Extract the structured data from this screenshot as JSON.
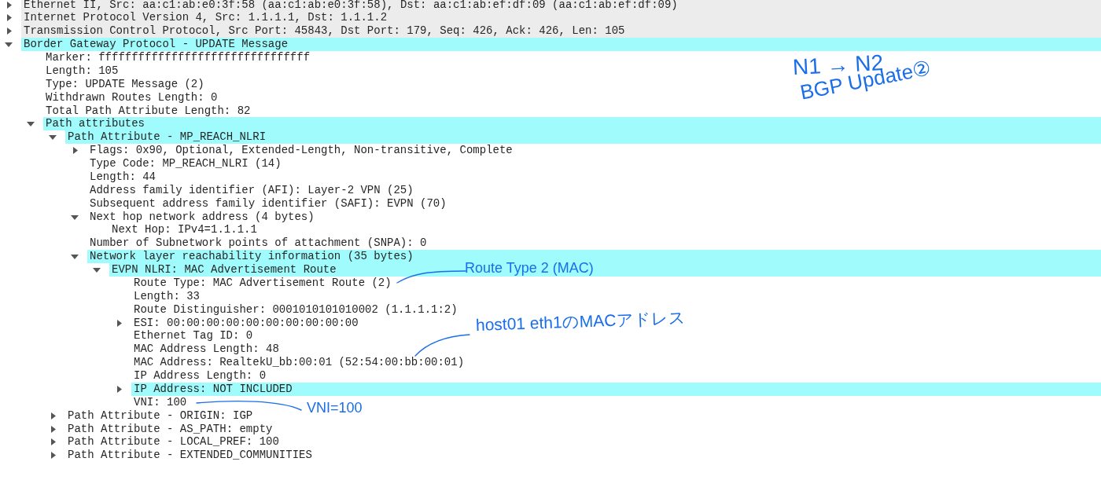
{
  "tree": [
    {
      "label": "Ethernet II, Src: aa:c1:ab:e0:3f:58 (aa:c1:ab:e0:3f:58), Dst: aa:c1:ab:ef:df:09 (aa:c1:ab:ef:df:09)",
      "expanded": false,
      "color": "#ececec"
    },
    {
      "label": "Internet Protocol Version 4, Src: 1.1.1.1, Dst: 1.1.1.2",
      "expanded": false,
      "color": "#ececec"
    },
    {
      "label": "Transmission Control Protocol, Src Port: 45843, Dst Port: 179, Seq: 426, Ack: 426, Len: 105",
      "expanded": false,
      "color": "#ececec"
    },
    {
      "label": "Border Gateway Protocol - UPDATE Message",
      "expanded": true,
      "color": "#a0fcfc",
      "children": [
        {
          "label": "Marker: ffffffffffffffffffffffffffffffff"
        },
        {
          "label": "Length: 105"
        },
        {
          "label": "Type: UPDATE Message (2)"
        },
        {
          "label": "Withdrawn Routes Length: 0"
        },
        {
          "label": "Total Path Attribute Length: 82"
        },
        {
          "label": "Path attributes",
          "expanded": true,
          "color": "#a0fcfc",
          "children": [
            {
              "label": "Path Attribute - MP_REACH_NLRI",
              "expanded": true,
              "color": "#a0fcfc",
              "children": [
                {
                  "label": "Flags: 0x90, Optional, Extended-Length, Non-transitive, Complete",
                  "expanded": false
                },
                {
                  "label": "Type Code: MP_REACH_NLRI (14)"
                },
                {
                  "label": "Length: 44"
                },
                {
                  "label": "Address family identifier (AFI): Layer-2 VPN (25)"
                },
                {
                  "label": "Subsequent address family identifier (SAFI): EVPN (70)"
                },
                {
                  "label": "Next hop network address (4 bytes)",
                  "expanded": true,
                  "children": [
                    {
                      "label": "Next Hop: IPv4=1.1.1.1"
                    }
                  ]
                },
                {
                  "label": "Number of Subnetwork points of attachment (SNPA): 0"
                },
                {
                  "label": "Network layer reachability information (35 bytes)",
                  "expanded": true,
                  "color": "#a0fcfc",
                  "children": [
                    {
                      "label": "EVPN NLRI: MAC Advertisement Route",
                      "expanded": true,
                      "color": "#a0fcfc",
                      "children": [
                        {
                          "label": "Route Type: MAC Advertisement Route (2)"
                        },
                        {
                          "label": "Length: 33"
                        },
                        {
                          "label": "Route Distinguisher: 0001010101010002 (1.1.1.1:2)"
                        },
                        {
                          "label": "ESI: 00:00:00:00:00:00:00:00:00:00",
                          "expanded": false
                        },
                        {
                          "label": "Ethernet Tag ID: 0"
                        },
                        {
                          "label": "MAC Address Length: 48"
                        },
                        {
                          "label": "MAC Address: RealtekU_bb:00:01 (52:54:00:bb:00:01)"
                        },
                        {
                          "label": "IP Address Length: 0"
                        },
                        {
                          "label": "IP Address: NOT INCLUDED",
                          "expanded": false,
                          "color": "#a0fcfc"
                        },
                        {
                          "label": "VNI: 100"
                        }
                      ]
                    }
                  ]
                }
              ]
            },
            {
              "label": "Path Attribute - ORIGIN: IGP",
              "expanded": false
            },
            {
              "label": "Path Attribute - AS_PATH: empty",
              "expanded": false
            },
            {
              "label": "Path Attribute - LOCAL_PREF: 100",
              "expanded": false
            },
            {
              "label": "Path Attribute - EXTENDED_COMMUNITIES",
              "expanded": false
            }
          ]
        }
      ]
    }
  ],
  "annotations": [
    {
      "text": "N1 → N2"
    },
    {
      "text": "BGP Update②"
    },
    {
      "text": "Route Type 2 (MAC)"
    },
    {
      "text": "host01 eth1のMACアドレス"
    },
    {
      "text": "VNI=100"
    }
  ]
}
